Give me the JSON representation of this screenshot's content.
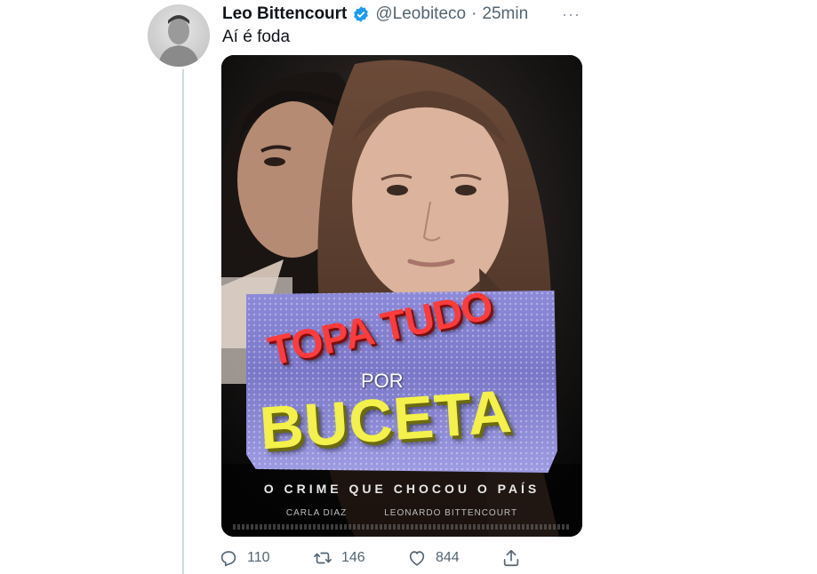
{
  "tweet": {
    "display_name": "Leo Bittencourt",
    "handle": "@Leobiteco",
    "separator": "·",
    "time": "25min",
    "more_label": "···",
    "text": "Aí é foda",
    "verified_icon": "verified-badge-icon"
  },
  "poster": {
    "title_line_1": "TOPA TUDO",
    "title_line_2": "POR",
    "title_line_3": "BUCETA",
    "tagline": "O CRIME QUE CHOCOU O PAÍS",
    "credit_1": "CARLA DIAZ",
    "credit_2": "LEONARDO BITTENCOURT"
  },
  "actions": {
    "reply_count": "110",
    "retweet_count": "146",
    "like_count": "844",
    "reply_icon": "reply-icon",
    "retweet_icon": "retweet-icon",
    "like_icon": "heart-icon",
    "share_icon": "share-icon"
  },
  "colors": {
    "text_primary": "#0f1419",
    "text_secondary": "#536471",
    "verified_blue": "#1d9bf0",
    "title_red": "#ff3b3b",
    "title_yellow": "#f3f14a",
    "card_purple": "#8d8bd9"
  }
}
